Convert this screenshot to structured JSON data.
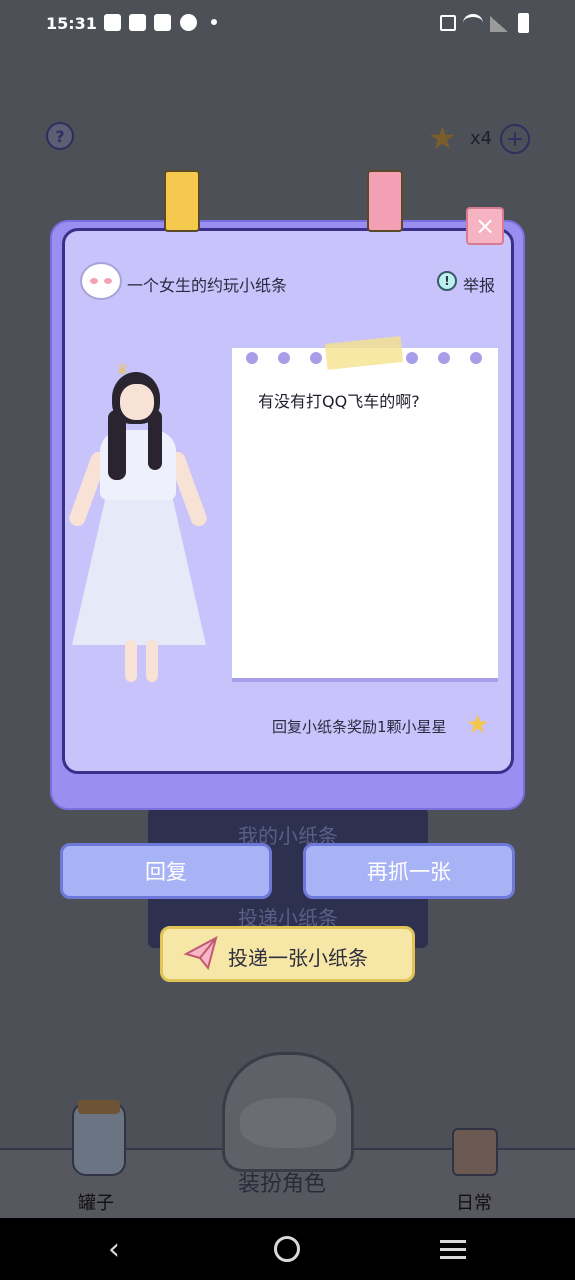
{
  "status_bar": {
    "time": "15:31"
  },
  "hud": {
    "help_icon": "?",
    "star_count": "x4",
    "plus_icon": "+"
  },
  "background_buttons": {
    "my_notes": "我的小纸条",
    "deliver_note": "投递小纸条"
  },
  "dialog": {
    "sender_label": "一个女生的约玩小纸条",
    "report_label": "举报",
    "note_text": "有没有打QQ飞车的啊?",
    "reward_text": "回复小纸条奖励1颗小星星",
    "close_icon": "×"
  },
  "actions": {
    "reply_label": "回复",
    "grab_again_label": "再抓一张",
    "send_note_label": "投递一张小纸条"
  },
  "bottom_nav": {
    "jar_label": "罐子",
    "role_label": "装扮角色",
    "daily_label": "日常"
  },
  "colors": {
    "dialog_bg": "#c9c3fb",
    "dialog_border": "#3b2f8a",
    "button_blue": "#a8b3f5",
    "button_yellow": "#f6e7a6",
    "star": "#f4c64a"
  }
}
